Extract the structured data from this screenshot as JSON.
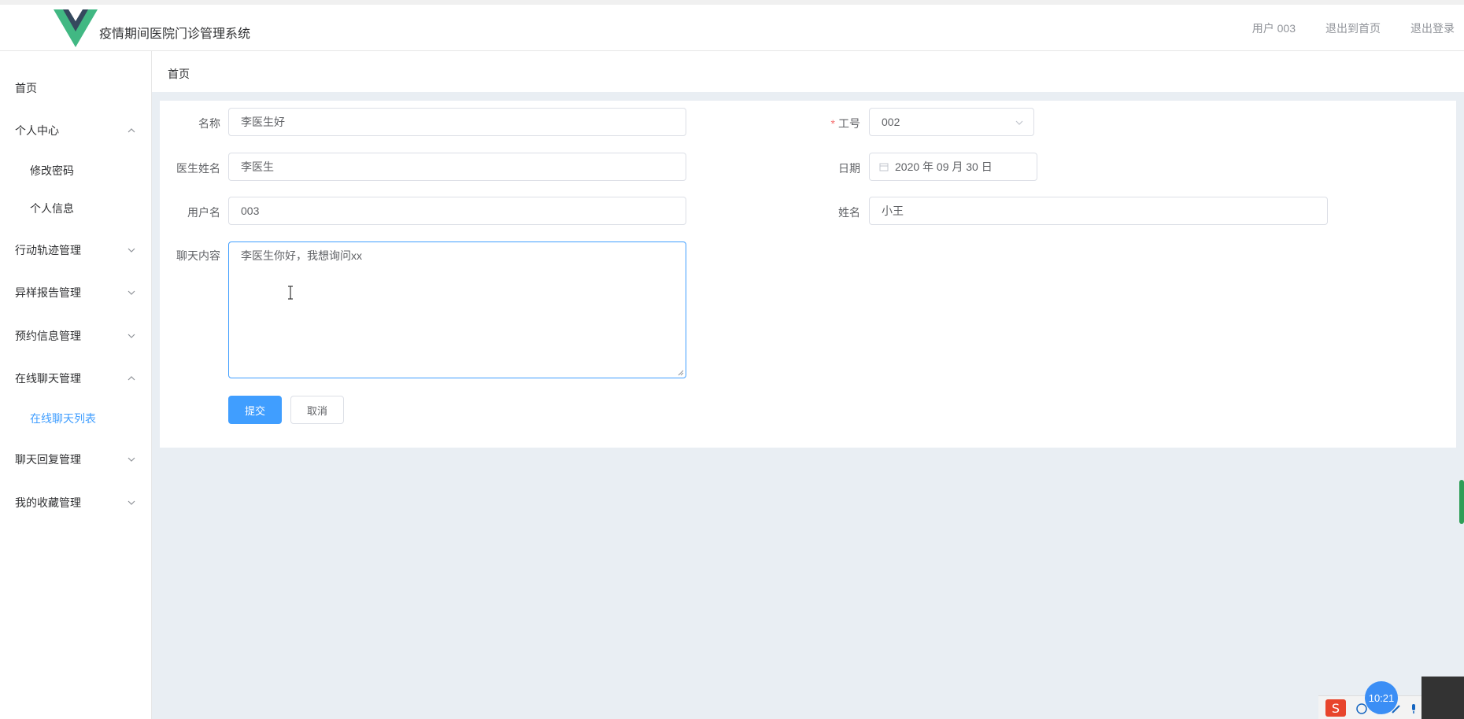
{
  "header": {
    "app_title": "疫情期间医院门诊管理系统",
    "user_label": "用户 003",
    "back_home_label": "退出到首页",
    "logout_label": "退出登录",
    "brand_colors": {
      "logo_green": "#41b883",
      "logo_dark": "#35495e"
    }
  },
  "sidebar": {
    "items": [
      {
        "label": "首页"
      },
      {
        "label": "个人中心",
        "expanded": true,
        "children": [
          {
            "label": "修改密码"
          },
          {
            "label": "个人信息"
          }
        ]
      },
      {
        "label": "行动轨迹管理",
        "expanded": false
      },
      {
        "label": "异样报告管理",
        "expanded": false
      },
      {
        "label": "预约信息管理",
        "expanded": false
      },
      {
        "label": "在线聊天管理",
        "expanded": true,
        "children": [
          {
            "label": "在线聊天列表",
            "active": true
          }
        ]
      },
      {
        "label": "聊天回复管理",
        "expanded": false
      },
      {
        "label": "我的收藏管理",
        "expanded": false
      }
    ]
  },
  "breadcrumb": {
    "current": "首页"
  },
  "form": {
    "name": {
      "label": "名称",
      "value": "李医生好"
    },
    "job_no": {
      "label": "工号",
      "required": true,
      "value": "002"
    },
    "doctor_name": {
      "label": "医生姓名",
      "value": "李医生"
    },
    "date": {
      "label": "日期",
      "value": "2020 年 09 月 30 日"
    },
    "username": {
      "label": "用户名",
      "value": "003"
    },
    "real_name": {
      "label": "姓名",
      "value": "小王"
    },
    "chat_content": {
      "label": "聊天内容",
      "value": "李医生你好，我想询问xx"
    },
    "submit_label": "提交",
    "cancel_label": "取消"
  },
  "taskbar": {
    "clock": "10:21"
  },
  "colors": {
    "primary": "#409eff",
    "page_bg": "#e9eef3",
    "required": "#f56c6c"
  }
}
